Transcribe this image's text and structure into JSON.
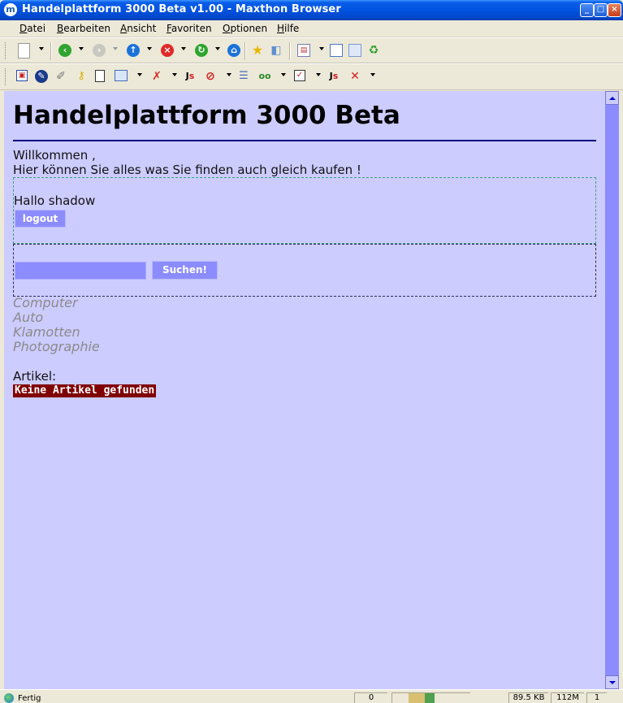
{
  "window": {
    "title": "Handelplattform 3000 Beta v1.00 - Maxthon Browser",
    "app_icon_glyph": "m",
    "minimize_glyph": "_",
    "maximize_glyph": "□",
    "close_glyph": "×"
  },
  "menu": {
    "items": [
      "Datei",
      "Bearbeiten",
      "Ansicht",
      "Favoriten",
      "Optionen",
      "Hilfe"
    ]
  },
  "toolbar1": {
    "icons": [
      "new-page-icon",
      "back-icon",
      "forward-icon",
      "up-icon",
      "stop-icon",
      "refresh-icon",
      "home-icon",
      "favorites-star-icon",
      "history-icon",
      "layout-icon",
      "fullscreen-icon",
      "panel-icon",
      "recycle-icon"
    ]
  },
  "toolbar2": {
    "icons": [
      "page-icon",
      "compass-icon",
      "tool-icon",
      "key-icon",
      "notepad-icon",
      "calendar-icon",
      "popup-block-icon",
      "js-icon",
      "block-icon",
      "list-icon",
      "glasses-icon",
      "checkbox-icon",
      "js-icon-2",
      "clear-icon"
    ]
  },
  "page": {
    "heading": "Handelplattform 3000 Beta",
    "welcome_line1": "Willkommen ,",
    "welcome_line2": "Hier können Sie alles was Sie finden auch gleich kaufen !",
    "hello": "Hallo shadow",
    "logout_label": "logout",
    "search_value": "",
    "search_button_label": "Suchen!",
    "categories": [
      "Computer",
      "Auto",
      "Klamotten",
      "Photographie"
    ],
    "articles_label": "Artikel:",
    "no_articles": "Keine Artikel gefunden"
  },
  "status": {
    "text": "Fertig",
    "count": "0",
    "size": "89.5 KB",
    "memory": "112M",
    "tail": "1"
  },
  "colors": {
    "page_background": "#ccccff",
    "button_background": "#8c8cff",
    "rule": "#000080",
    "no_articles_background": "#800000",
    "category_text": "#8a8a8a"
  }
}
